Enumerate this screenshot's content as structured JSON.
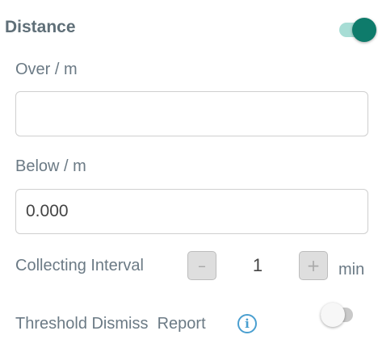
{
  "distance": {
    "title": "Distance",
    "enabled": true,
    "toggle_color": "#0e7b6b",
    "over_label": "Over / m",
    "over_value": "",
    "below_label": "Below / m",
    "below_value": "0.000"
  },
  "collecting_interval": {
    "label": "Collecting Interval",
    "minus": "–",
    "value": "1",
    "plus": "+",
    "unit": "min"
  },
  "threshold_dismiss_report": {
    "label": "Threshold Dismiss  Report",
    "info_icon": "i",
    "enabled": false
  }
}
